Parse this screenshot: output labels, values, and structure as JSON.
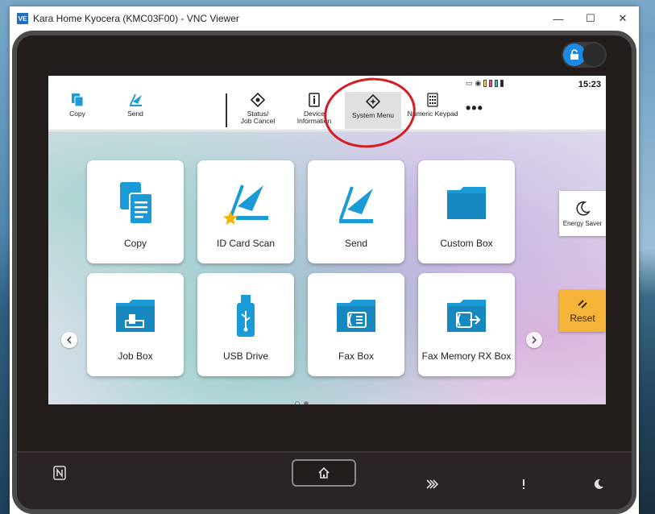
{
  "window": {
    "app_icon": "VE",
    "title": "Kara Home Kyocera (KMC03F00) - VNC Viewer",
    "minimize": "—",
    "maximize": "☐",
    "close": "✕"
  },
  "status_bar": {
    "time": "15:23"
  },
  "quick_bar": {
    "items": [
      {
        "label": "Copy",
        "icon": "copy-icon"
      },
      {
        "label": "Send",
        "icon": "send-icon"
      },
      {
        "label": "Status/\nJob Cancel",
        "icon": "status-icon"
      },
      {
        "label": "Device\nInformation",
        "icon": "device-info-icon"
      },
      {
        "label": "System Menu",
        "icon": "system-menu-icon",
        "selected": true
      },
      {
        "label": "Numeric Keypad",
        "icon": "keypad-icon"
      }
    ],
    "more": "•••"
  },
  "tiles": [
    {
      "label": "Copy",
      "icon": "copy-icon"
    },
    {
      "label": "ID Card Scan",
      "icon": "id-card-scan-icon"
    },
    {
      "label": "Send",
      "icon": "send-icon"
    },
    {
      "label": "Custom Box",
      "icon": "folder-icon"
    },
    {
      "label": "Job Box",
      "icon": "job-box-icon"
    },
    {
      "label": "USB Drive",
      "icon": "usb-icon"
    },
    {
      "label": "Fax Box",
      "icon": "fax-box-icon"
    },
    {
      "label": "Fax Memory RX Box",
      "icon": "fax-memory-icon"
    }
  ],
  "side": {
    "energy_saver": "Energy Saver",
    "reset": "Reset"
  },
  "pager": {
    "current": 1,
    "total": 2
  },
  "colors": {
    "accent": "#1a9ad6",
    "reset": "#f5b33a",
    "annotation": "#d41c24",
    "star": "#f4b400"
  }
}
